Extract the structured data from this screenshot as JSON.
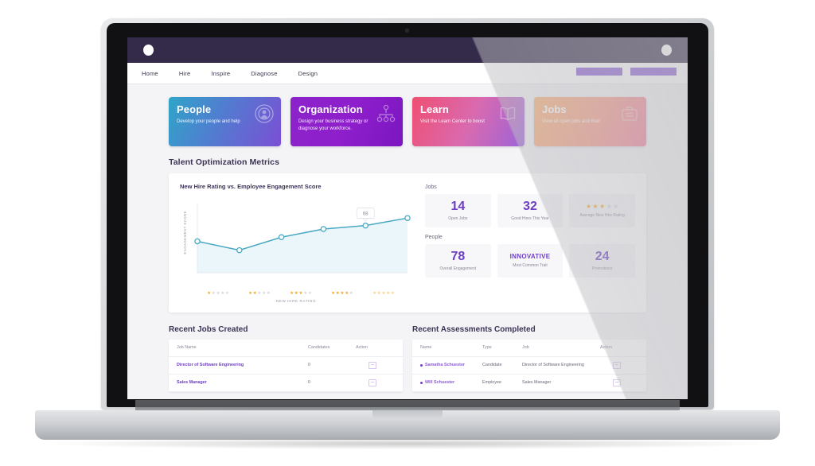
{
  "header": {
    "left_dot": "window-dot",
    "right_dot": "window-dot"
  },
  "nav": {
    "items": [
      {
        "label": "Home"
      },
      {
        "label": "Hire"
      },
      {
        "label": "Inspire"
      },
      {
        "label": "Diagnose"
      },
      {
        "label": "Design"
      }
    ],
    "accent": "#8b5cd6"
  },
  "cards": [
    {
      "title": "People",
      "subtitle": "Develop your people and help",
      "icon": "people-target-icon",
      "gradient_from": "#2fa5c8",
      "gradient_to": "#7b4fd4"
    },
    {
      "title": "Organization",
      "subtitle": "Design your business strategy or diagnose your workforce.",
      "icon": "org-chart-icon",
      "gradient_from": "#8b23c9",
      "gradient_to": "#7a16c0"
    },
    {
      "title": "Learn",
      "subtitle": "Visit the Learn Center to boost",
      "icon": "book-icon",
      "gradient_from": "#ef4f72",
      "gradient_to": "#9b63d8"
    },
    {
      "title": "Jobs",
      "subtitle": "View all open jobs and their",
      "icon": "briefcase-icon",
      "gradient_from": "#fbb273",
      "gradient_to": "#f47c9b"
    }
  ],
  "metrics_section": {
    "title": "Talent Optimization Metrics"
  },
  "chart_data": {
    "type": "line",
    "title": "New Hire Rating vs. Employee Engagement Score",
    "xlabel": "NEW HIRE RATING",
    "ylabel": "ENGAGEMENT SCORE",
    "categories": [
      "1 star",
      "2 stars",
      "3 stars",
      "4 stars",
      "5 stars"
    ],
    "star_groups": [
      {
        "filled": 1,
        "total": 5,
        "faded": false
      },
      {
        "filled": 2,
        "total": 5,
        "faded": false
      },
      {
        "filled": 3,
        "total": 5,
        "faded": false
      },
      {
        "filled": 4,
        "total": 5,
        "faded": false
      },
      {
        "filled": 5,
        "total": 5,
        "faded": true
      }
    ],
    "x": [
      0,
      1,
      2,
      3,
      4,
      5
    ],
    "values": [
      46,
      33,
      52,
      64,
      69,
      80
    ],
    "tooltip": {
      "value": "68",
      "point_index": 4
    },
    "line_color": "#49a8c4",
    "area_fill": "#d9eef6",
    "grid": false,
    "ylim": [
      0,
      100
    ]
  },
  "stats": {
    "groups": [
      {
        "label": "Jobs",
        "items": [
          {
            "value": "14",
            "caption": "Open Jobs",
            "kind": "number"
          },
          {
            "value": "32",
            "caption": "Good Hires This Year",
            "kind": "number"
          },
          {
            "value": "3",
            "caption": "Average New Hire Rating",
            "kind": "stars",
            "stars_total": 5
          }
        ]
      },
      {
        "label": "People",
        "items": [
          {
            "value": "78",
            "caption": "Overall Engagement",
            "kind": "number"
          },
          {
            "value": "INNOVATIVE",
            "caption": "Most Common Trait",
            "kind": "word"
          },
          {
            "value": "24",
            "caption": "Promotions",
            "kind": "number"
          }
        ]
      }
    ]
  },
  "jobs_table": {
    "title": "Recent Jobs Created",
    "columns": [
      "Job Name",
      "Candidates",
      "Action"
    ],
    "rows": [
      {
        "job_name": "Director of Software Engineering",
        "candidates": "0"
      },
      {
        "job_name": "Sales Manager",
        "candidates": "0"
      }
    ]
  },
  "assessments_table": {
    "title": "Recent Assessments Completed",
    "columns": [
      "Name",
      "Type",
      "Job",
      "Action"
    ],
    "rows": [
      {
        "name": "Samatha Schuester",
        "type": "Candidate",
        "job": "Director of Software Engineering"
      },
      {
        "name": "Will Schuester",
        "type": "Employee",
        "job": "Sales Manager"
      }
    ]
  }
}
